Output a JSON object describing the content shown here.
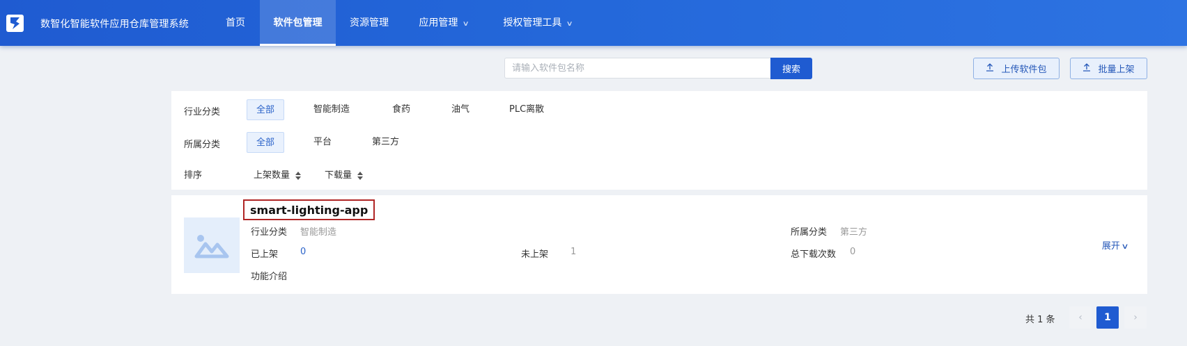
{
  "header": {
    "app_title": "数智化智能软件应用仓库管理系统",
    "logo_icon": "s-logo-icon",
    "nav": [
      {
        "label": "首页",
        "active": false,
        "dropdown": false
      },
      {
        "label": "软件包管理",
        "active": true,
        "dropdown": false
      },
      {
        "label": "资源管理",
        "active": false,
        "dropdown": false
      },
      {
        "label": "应用管理",
        "active": false,
        "dropdown": true
      },
      {
        "label": "授权管理工具",
        "active": false,
        "dropdown": true
      }
    ]
  },
  "search": {
    "placeholder": "请输入软件包名称",
    "value": "",
    "button_label": "搜索"
  },
  "toolbar": {
    "upload_label": "上传软件包",
    "batch_label": "批量上架",
    "icon": "upload-icon"
  },
  "filters": {
    "industry": {
      "label": "行业分类",
      "options": [
        "全部",
        "智能制造",
        "食药",
        "油气",
        "PLC离散"
      ],
      "selected": "全部"
    },
    "category": {
      "label": "所属分类",
      "options": [
        "全部",
        "平台",
        "第三方"
      ],
      "selected": "全部"
    },
    "sort": {
      "label": "排序",
      "options": [
        "上架数量",
        "下载量"
      ]
    }
  },
  "package": {
    "name": "smart-lighting-app",
    "thumbnail_icon": "image-placeholder-icon",
    "industry_label": "行业分类",
    "industry_value": "智能制造",
    "category_label": "所属分类",
    "category_value": "第三方",
    "listed_label": "已上架",
    "listed_value": "0",
    "unlisted_label": "未上架",
    "unlisted_value": "1",
    "downloads_label": "总下载次数",
    "downloads_value": "0",
    "intro_label": "功能介绍",
    "expand_label": "展开"
  },
  "pagination": {
    "total_label": "共 1 条",
    "current_page": "1",
    "prev_icon": "chevron-left-icon",
    "next_icon": "chevron-right-icon"
  },
  "colors": {
    "primary": "#1f5bd1",
    "highlight_border": "#b02525",
    "active_bg": "#e9f1fd"
  }
}
